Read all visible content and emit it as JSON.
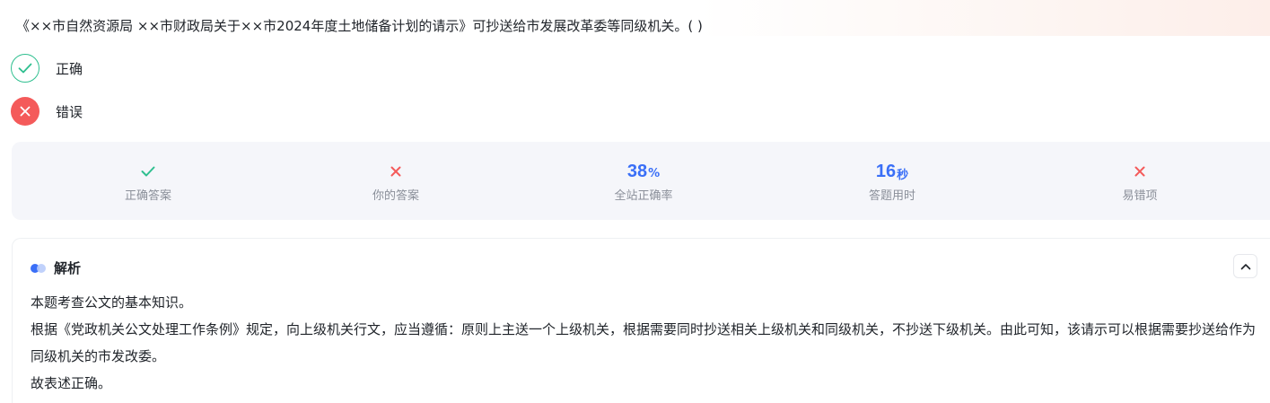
{
  "question": {
    "text": "《××市自然资源局 ××市财政局关于××市2024年度土地储备计划的请示》可抄送给市发展改革委等同级机关。( )"
  },
  "options": [
    {
      "label": "正确",
      "state": "correct"
    },
    {
      "label": "错误",
      "state": "wrong"
    }
  ],
  "stats": {
    "correct_answer": {
      "icon": "check-icon",
      "label": "正确答案"
    },
    "your_answer": {
      "icon": "cross-icon",
      "label": "你的答案"
    },
    "accuracy": {
      "value": "38",
      "unit": "%",
      "label": "全站正确率"
    },
    "time": {
      "value": "16",
      "unit": "秒",
      "label": "答题用时"
    },
    "error_prone": {
      "icon": "cross-icon",
      "label": "易错项"
    }
  },
  "analysis": {
    "title": "解析",
    "paragraphs": [
      "本题考查公文的基本知识。",
      "根据《党政机关公文处理工作条例》规定，向上级机关行文，应当遵循：原则上主送一个上级机关，根据需要同时抄送相关上级机关和同级机关，不抄送下级机关。由此可知，该请示可以根据需要抄送给作为同级机关的市发改委。",
      "故表述正确。"
    ]
  },
  "colors": {
    "correct": "#2fbf8f",
    "wrong": "#f45a5a",
    "accent": "#3a6ff7"
  }
}
